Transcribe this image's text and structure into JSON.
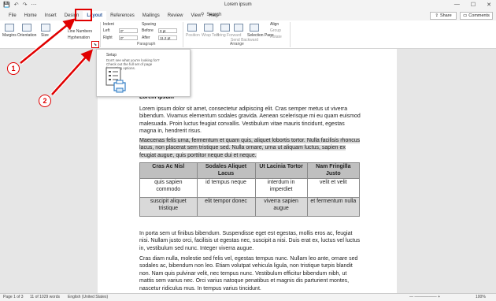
{
  "titlebar": {
    "doc_title": "Lorem ipsum",
    "qat": [
      "💾",
      "↶",
      "↷",
      "⋯"
    ],
    "win_controls": [
      "—",
      "☐",
      "✕"
    ]
  },
  "tabs": [
    "File",
    "Home",
    "Insert",
    "Design",
    "Layout",
    "References",
    "Mailings",
    "Review",
    "View",
    "Help"
  ],
  "active_tab": "Layout",
  "search_label": "Search",
  "share_label": "Share",
  "comments_label": "Comments",
  "ribbon": {
    "margins": "Margins",
    "orientation": "Orientation",
    "size": "Size",
    "line_numbers": "Line Numbers",
    "hyphenation": "Hyphenation",
    "indent": "Indent",
    "spacing": "Spacing",
    "left_label": "Left",
    "right_label": "Right",
    "before_label": "Before",
    "after_label": "After",
    "left_value": "0\"",
    "right_value": "0\"",
    "before_value": "0 pt",
    "after_value": "11.2 pt",
    "paragraph_group": "Paragraph",
    "arrange_group": "Arrange",
    "position": "Position",
    "wrap_text": "Wrap Text",
    "bring_forward": "Bring Forward",
    "send_backward": "Send Backward",
    "selection_pane": "Selection Pane",
    "align": "Align",
    "group": "Group",
    "rotate": "Rotate"
  },
  "tooltip": {
    "title": "Setup",
    "line1": "Don't see what you're looking for?",
    "line2": "Check out the full set of page",
    "line3": "formatting options."
  },
  "document": {
    "heading": "Lorem ipsum",
    "p1": "Lorem ipsum dolor sit amet, consectetur adipiscing elit. Cras semper metus ut viverra bibendum. Vivamus elementum sodales gravida. Aenean scelerisque mi eu quam euismod malesuada. Proin luctus feugiat convallis. Vestibulum vitae mauris tincidunt, egestas magna in, hendrerit risus.",
    "p2": "Maecenas felis urna, fermentum et quam quis, aliquet lobortis tortor. Nulla facilisis rhoncus lacus, non placerat sem tristique sed. Nulla ornare, urna ut aliquam luctus, sapien ex feugiat augue, quis porttitor neque dui et neque.",
    "table": {
      "headers": [
        "Cras Ac Nisl",
        "Sodales Aliquet Lacus",
        "Ut Lacinia Tortor",
        "Nam Fringilla Justo"
      ],
      "rows": [
        [
          "quis sapien commodo",
          "id tempus neque",
          "interdum in imperdiet",
          "velit et velit"
        ],
        [
          "suscipit aliquet tristique",
          "elit tempor donec",
          "viverra sapien augue",
          "et fermentum nulla"
        ]
      ]
    },
    "p3": "In porta sem ut finibus bibendum. Suspendisse eget est egestas, mollis eros ac, feugiat nisi. Nullam justo orci, facilisis ut egestas nec, suscipit a nisi. Duis erat ex, luctus vel luctus in, vestibulum sed nunc. Integer viverra augue.",
    "p4": "Cras diam nulla, molestie sed felis vel, egestas tempus nunc. Nullam leo ante, ornare sed sodales ac, bibendum non leo. Etiam volutpat vehicula ligula, non tristique turpis blandit non. Nam quis pulvinar velit, nec tempus nunc. Vestibulum efficitur bibendum nibh, ut mattis sem varius nec. Orci varius natoque penatibus et magnis dis parturient montes, nascetur ridiculus mus. In tempus varius tincidunt."
  },
  "status": {
    "page": "Page 1 of 3",
    "words": "11 of 1029 words",
    "language": "English (United States)",
    "zoom": "100%"
  },
  "annotations": {
    "badge1": "1",
    "badge2": "2",
    "color": "#e00000"
  }
}
